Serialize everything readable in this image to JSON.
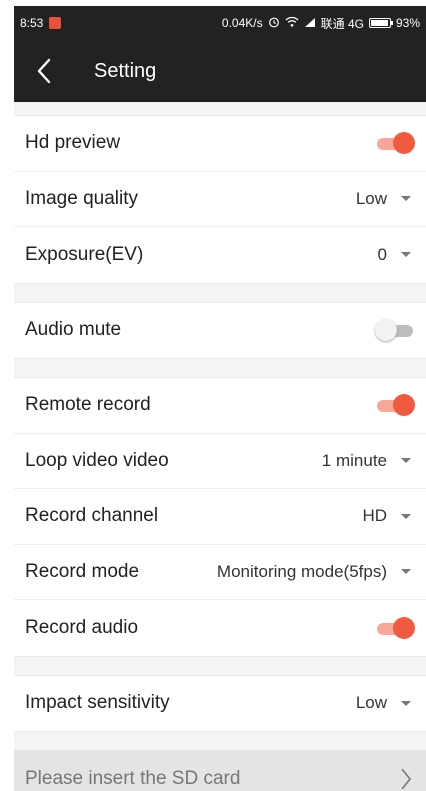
{
  "statusbar": {
    "time": "8:53",
    "speed": "0.04K/s",
    "carrier": "联通 4G",
    "battery": "93%"
  },
  "header": {
    "title": "Setting",
    "back_icon": "chevron-left-icon"
  },
  "colors": {
    "bar": "#222222",
    "toggle_on": "#f05a3f",
    "toggle_off": "#bdbdbd"
  },
  "settings": {
    "hd_preview": {
      "label": "Hd preview",
      "on": true
    },
    "image_quality": {
      "label": "Image quality",
      "value": "Low"
    },
    "exposure": {
      "label": "Exposure(EV)",
      "value": "0"
    },
    "audio_mute": {
      "label": "Audio mute",
      "on": false
    },
    "remote_record": {
      "label": "Remote record",
      "on": true
    },
    "loop_video": {
      "label": "Loop video video",
      "value": "1 minute"
    },
    "record_channel": {
      "label": "Record channel",
      "value": "HD"
    },
    "record_mode": {
      "label": "Record mode",
      "value": "Monitoring mode(5fps)"
    },
    "record_audio": {
      "label": "Record audio",
      "on": true
    },
    "impact_sensitivity": {
      "label": "Impact sensitivity",
      "value": "Low"
    }
  },
  "sd_card": {
    "label": "Please insert the SD card"
  }
}
